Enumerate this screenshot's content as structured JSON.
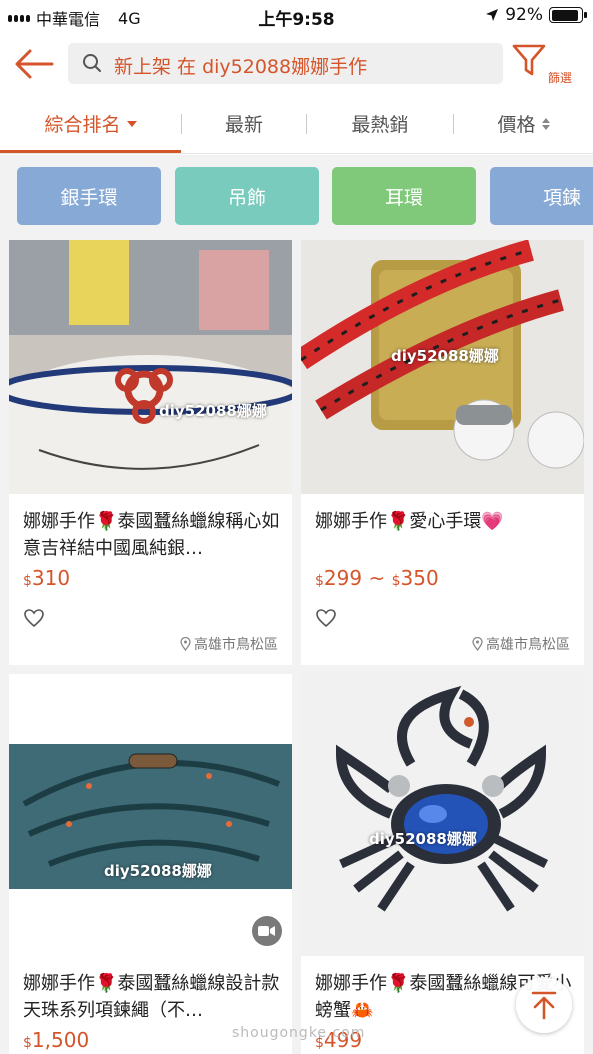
{
  "status_bar": {
    "carrier": "中華電信",
    "network": "4G",
    "time": "上午9:58",
    "battery": "92%",
    "battery_level": 0.92
  },
  "header": {
    "back_icon": "arrow-left-icon",
    "search_query": "新上架 在 diy52088娜娜手作",
    "filter_label": "篩選"
  },
  "sort_tabs": [
    {
      "label": "綜合排名",
      "active": true
    },
    {
      "label": "最新",
      "active": false
    },
    {
      "label": "最熱銷",
      "active": false
    },
    {
      "label": "價格",
      "active": false
    }
  ],
  "categories": [
    {
      "label": "銀手環",
      "color": "#86a9d6"
    },
    {
      "label": "吊飾",
      "color": "#78cbbd"
    },
    {
      "label": "耳環",
      "color": "#81c97a"
    },
    {
      "label": "項鍊",
      "color": "#86a9d6"
    }
  ],
  "products": [
    {
      "title": "娜娜手作🌹泰國蠶絲蠟線稱心如意吉祥結中國風純銀…",
      "price_symbol": "$",
      "price": "310",
      "location": "高雄市鳥松區",
      "watermark": "diy52088娜娜"
    },
    {
      "title": "娜娜手作🌹愛心手環💗",
      "price_symbol": "$",
      "price": "299",
      "price_separator": " ~ ",
      "price_symbol2": "$",
      "price_max": "350",
      "location": "高雄市鳥松區",
      "watermark": "diy52088娜娜"
    },
    {
      "title": "娜娜手作🌹泰國蠶絲蠟線設計款天珠系列項鍊繩（不…",
      "price_symbol": "$",
      "price": "1,500",
      "watermark": "diy52088娜娜"
    },
    {
      "title": "娜娜手作🌹泰國蠶絲蠟線可愛小螃蟹🦀",
      "price_symbol": "$",
      "price": "499",
      "watermark": "diy52088娜娜"
    }
  ],
  "site_watermark": "shougongke.com",
  "colors": {
    "accent": "#d5552b",
    "grid_bg": "#f2f2f2"
  }
}
